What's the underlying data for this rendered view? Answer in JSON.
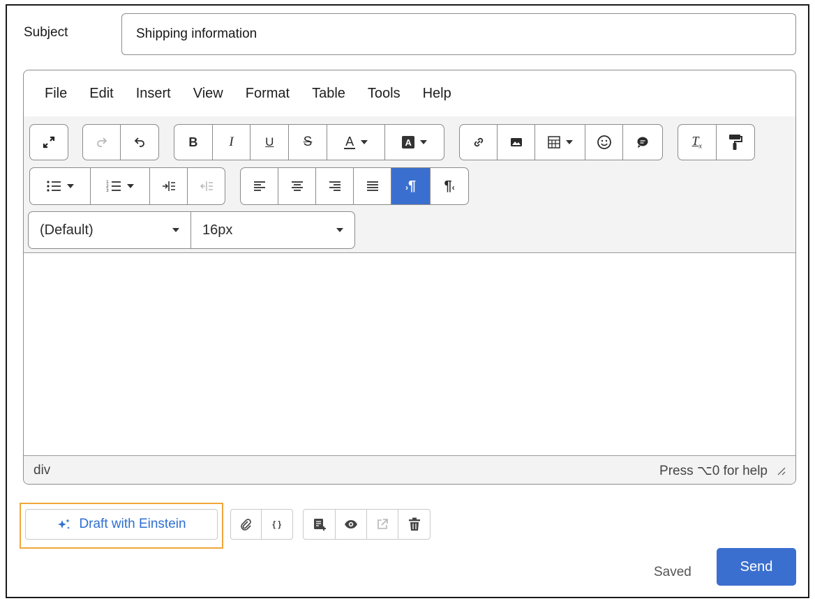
{
  "subject": {
    "label": "Subject",
    "value": "Shipping information"
  },
  "menu": [
    "File",
    "Edit",
    "Insert",
    "View",
    "Format",
    "Table",
    "Tools",
    "Help"
  ],
  "fonts": {
    "family": "(Default)",
    "size": "16px"
  },
  "status": {
    "path": "div",
    "help": "Press ⌥0 for help"
  },
  "actions": {
    "einstein": "Draft with Einstein",
    "saved": "Saved",
    "send": "Send",
    "merge_field_glyph": "{ }"
  },
  "colors": {
    "accent": "#3b6fcf",
    "highlight": "#f0a63a"
  },
  "icons": [
    "fullscreen-icon",
    "redo-icon",
    "undo-icon",
    "bold-icon",
    "italic-icon",
    "underline-icon",
    "strikethrough-icon",
    "text-color-icon",
    "highlight-color-icon",
    "link-icon",
    "image-icon",
    "table-icon",
    "emoji-icon",
    "comment-icon",
    "clear-format-icon",
    "format-painter-icon",
    "bullet-list-icon",
    "numbered-list-icon",
    "indent-icon",
    "outdent-icon",
    "align-left-icon",
    "align-center-icon",
    "align-right-icon",
    "justify-icon",
    "ltr-icon",
    "rtl-icon",
    "sparkle-icon",
    "attach-icon",
    "merge-field-icon",
    "template-icon",
    "preview-icon",
    "popout-icon",
    "delete-icon",
    "resize-handle-icon"
  ]
}
